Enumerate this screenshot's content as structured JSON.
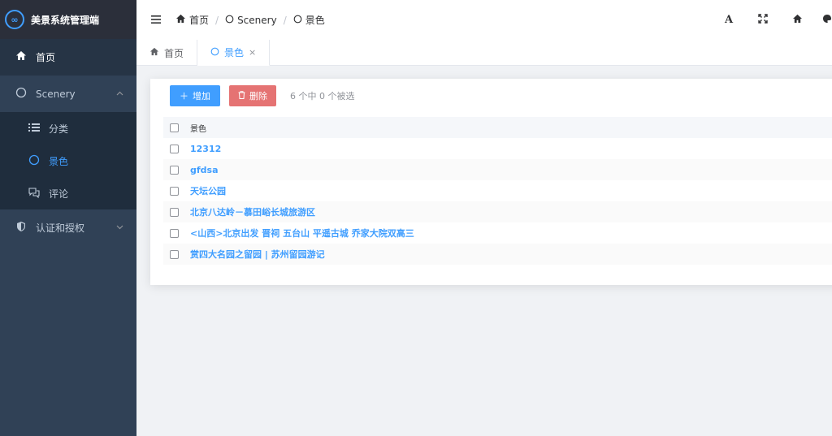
{
  "app": {
    "title": "美景系统管理端",
    "logo_glyph": "∞"
  },
  "sidebar": {
    "items": [
      {
        "label": "首页",
        "icon": "home-icon"
      },
      {
        "label": "Scenery",
        "icon": "circle-icon",
        "children": [
          {
            "label": "分类",
            "icon": "list-icon"
          },
          {
            "label": "景色",
            "icon": "circle-icon"
          },
          {
            "label": "评论",
            "icon": "comment-icon"
          }
        ]
      },
      {
        "label": "认证和授权",
        "icon": "shield-icon"
      }
    ]
  },
  "breadcrumb": [
    {
      "label": "首页"
    },
    {
      "label": "Scenery"
    },
    {
      "label": "景色"
    }
  ],
  "navbar_right": {
    "font_label": "A"
  },
  "tabs": [
    {
      "label": "首页",
      "active": false
    },
    {
      "label": "景色",
      "active": true,
      "close": "×"
    }
  ],
  "toolbar": {
    "add_label": "增加",
    "delete_label": "删除",
    "selection_text": "6 个中 0 个被选"
  },
  "table": {
    "column": "景色",
    "rows": [
      "12312",
      "gfdsa",
      "天坛公园",
      "北京八达岭－慕田峪长城旅游区",
      "<山西>北京出发 晋祠 五台山 平遥古城 乔家大院双高三",
      "赏四大名园之留园 | 苏州留园游记"
    ]
  },
  "colors": {
    "sidebar_bg": "#304156",
    "accent": "#409eff",
    "danger": "#e57373"
  }
}
